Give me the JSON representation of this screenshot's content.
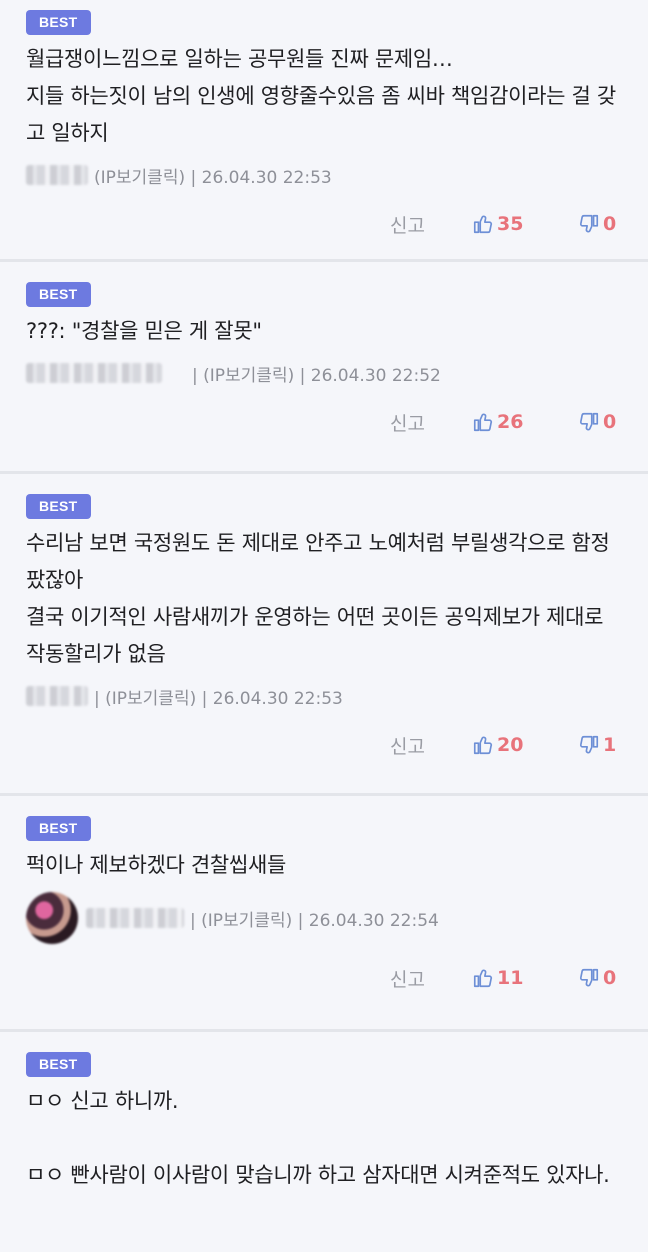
{
  "comments": [
    {
      "badge": "BEST",
      "text": "월급쟁이느낌으로 일하는 공무원들 진짜 문제임…\n지들 하는짓이 남의 인생에 영향줄수있음 좀 씨바 책임감이라는 걸 갖고 일하지",
      "meta": "(IP보기클릭) | 26.04.30 22:53",
      "report": "신고",
      "likes": "35",
      "dislikes": "0"
    },
    {
      "badge": "BEST",
      "text": "???: \"경찰을 믿은 게 잘못\"",
      "meta": "| (IP보기클릭) | 26.04.30 22:52",
      "report": "신고",
      "likes": "26",
      "dislikes": "0"
    },
    {
      "badge": "BEST",
      "text": "수리남 보면 국정원도 돈 제대로 안주고 노예처럼 부릴생각으로 함정 팠잖아\n결국 이기적인 사람새끼가 운영하는 어떤 곳이든 공익제보가 제대로 작동할리가 없음",
      "meta": "| (IP보기클릭) | 26.04.30 22:53",
      "report": "신고",
      "likes": "20",
      "dislikes": "1"
    },
    {
      "badge": "BEST",
      "text": "퍽이나 제보하겠다 견찰씹새들",
      "meta": "| (IP보기클릭) | 26.04.30 22:54",
      "report": "신고",
      "likes": "11",
      "dislikes": "0"
    },
    {
      "badge": "BEST",
      "text": "ㅁㅇ 신고 하니까.\n\nㅁㅇ 빤사람이 이사람이 맞습니까 하고 삼자대면 시켜준적도 있자나."
    }
  ],
  "colors": {
    "badge": "#6d7ae0",
    "like_icon": "#6d8fd6",
    "count": "#e8737b"
  }
}
